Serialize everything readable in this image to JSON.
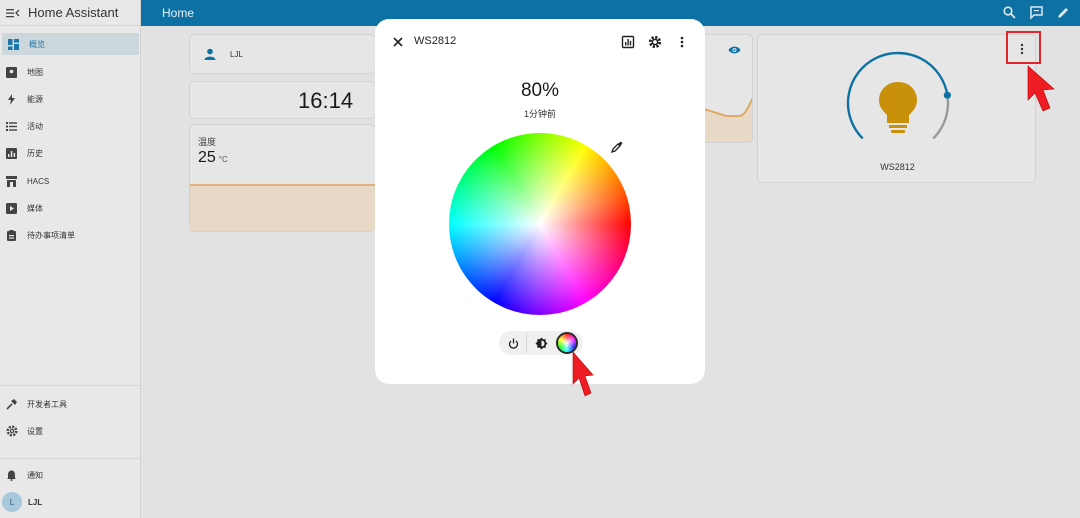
{
  "app": {
    "title": "Home Assistant"
  },
  "sidebar": {
    "items": [
      {
        "label": "概览",
        "icon": "dashboard-icon",
        "active": true
      },
      {
        "label": "地图",
        "icon": "map-icon"
      },
      {
        "label": "能源",
        "icon": "energy-icon"
      },
      {
        "label": "活动",
        "icon": "logbook-icon"
      },
      {
        "label": "历史",
        "icon": "history-icon"
      },
      {
        "label": "HACS",
        "icon": "hacs-icon"
      },
      {
        "label": "媒体",
        "icon": "media-icon"
      },
      {
        "label": "待办事项清单",
        "icon": "todo-icon"
      },
      {
        "label": "开发者工具",
        "icon": "hammer-icon"
      },
      {
        "label": "设置",
        "icon": "gear-icon"
      },
      {
        "label": "通知",
        "icon": "bell-icon"
      },
      {
        "label": "LJL",
        "icon": "avatar",
        "avatar_letter": "L"
      }
    ]
  },
  "topbar": {
    "title": "Home"
  },
  "cards": {
    "person": {
      "name": "LJL"
    },
    "clock": {
      "time": "16:14"
    },
    "temperature": {
      "label": "温度",
      "value": "25",
      "unit": "°C"
    },
    "light": {
      "name": "WS2812",
      "brightness_fraction": 0.8
    }
  },
  "dialog": {
    "title": "WS2812",
    "brightness": "80%",
    "last_changed": "1分钟前",
    "modes": [
      "power",
      "brightness",
      "color"
    ],
    "active_mode": "color"
  },
  "colors": {
    "topbar": "#0d72a3",
    "accent": "#1c76a8",
    "bulb": "#c9900a",
    "highlight": "#e0262a"
  }
}
